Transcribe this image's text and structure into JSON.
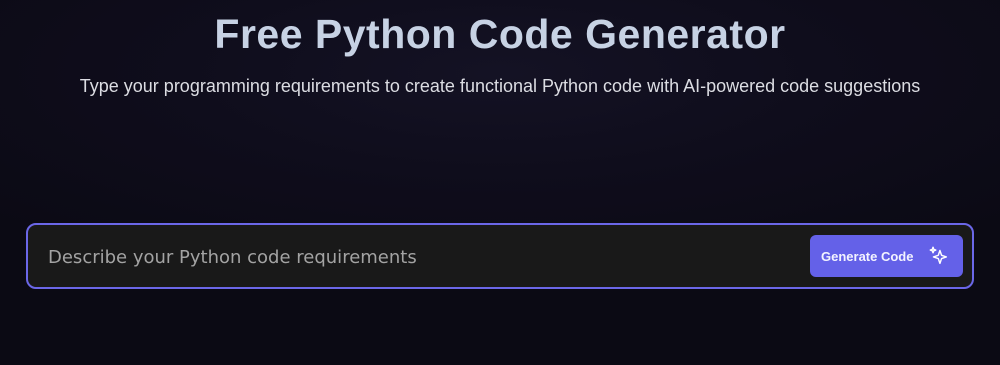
{
  "hero": {
    "title": "Free Python Code Generator",
    "subtitle": "Type your programming requirements to create functional Python code with AI-powered code suggestions"
  },
  "prompt": {
    "placeholder": "Describe your Python code requirements",
    "value": "",
    "generate_label": "Generate Code",
    "generate_icon": "sparkle-icon"
  },
  "colors": {
    "accent": "#6461e8",
    "border": "#6b67e8",
    "background": "#0f0d1c",
    "input_background": "#191919",
    "title": "#c7d2e4"
  }
}
